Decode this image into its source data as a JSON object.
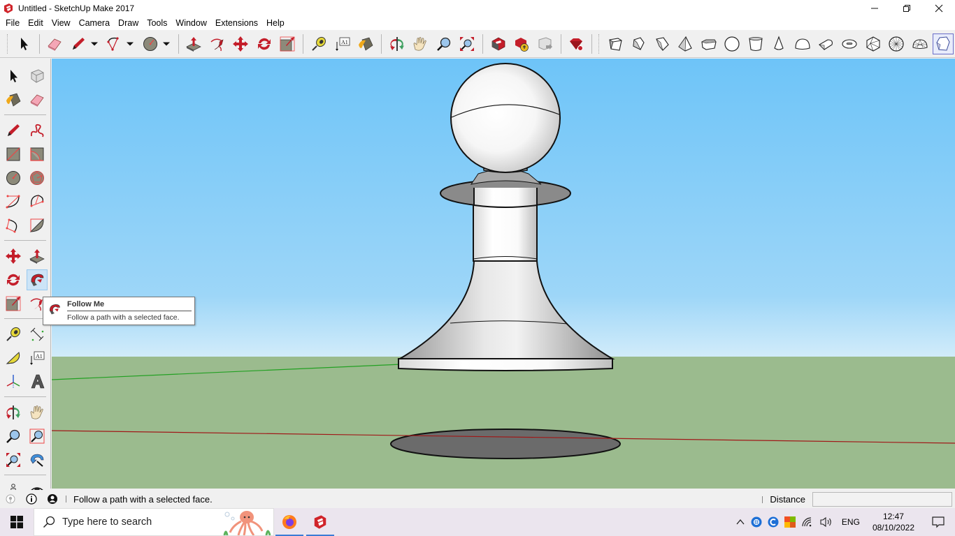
{
  "window": {
    "title": "Untitled - SketchUp Make 2017",
    "controls": [
      "minimize",
      "restore",
      "close"
    ]
  },
  "menu": [
    "File",
    "Edit",
    "View",
    "Camera",
    "Draw",
    "Tools",
    "Window",
    "Extensions",
    "Help"
  ],
  "toolbar": {
    "large_tools": [
      "select-icon",
      "eraser-icon",
      "pencil-icon",
      "arc-icon",
      "circle-icon",
      "push-pull-icon",
      "follow-me-icon",
      "move-icon",
      "rotate-icon",
      "scale-icon",
      "tape-measure-icon",
      "text-icon",
      "paint-bucket-icon",
      "orbit-icon",
      "pan-icon",
      "zoom-icon",
      "zoom-extents-icon",
      "warehouse-icon",
      "extension-warehouse-icon",
      "layout-icon",
      "ruby-console-icon"
    ],
    "shapes": [
      "cube",
      "pentagonal-prism",
      "pentagonal-box",
      "tetrahedron",
      "octagonal-prism",
      "sphere",
      "cylinder",
      "cone",
      "dome",
      "half-cylinder",
      "torus",
      "icosahedron",
      "geodesic-sphere",
      "geodesic-dome",
      "selected-shape"
    ]
  },
  "left_toolbar": {
    "tools": [
      [
        "select",
        "make-component"
      ],
      [
        "paint-bucket",
        "eraser"
      ],
      [
        "line",
        "freehand"
      ],
      [
        "rectangle",
        "rotated-rectangle"
      ],
      [
        "circle",
        "polygon"
      ],
      [
        "arc",
        "two-point-arc"
      ],
      [
        "three-point-arc",
        "pie"
      ],
      [
        "move",
        "push-pull"
      ],
      [
        "rotate",
        "follow-me"
      ],
      [
        "scale",
        "offset"
      ],
      [
        "tape-measure",
        "dimension"
      ],
      [
        "protractor",
        "text"
      ],
      [
        "axes",
        "3d-text"
      ],
      [
        "orbit",
        "pan"
      ],
      [
        "zoom",
        "zoom-window"
      ],
      [
        "zoom-extents",
        "previous"
      ],
      [
        "position-camera",
        "look-around"
      ]
    ],
    "active": "follow-me"
  },
  "tooltip": {
    "title": "Follow Me",
    "description": "Follow a path with a selected face."
  },
  "viewport": {
    "sky_color": "#6ec4f8",
    "ground_color": "#9bbb8e",
    "model": "chess pawn",
    "axis_colors": {
      "green": "#22a022",
      "red": "#a01818"
    }
  },
  "statusbar": {
    "message": "Follow a path with a selected face.",
    "vcb_label": "Distance",
    "vcb_value": ""
  },
  "taskbar": {
    "search_placeholder": "Type here to search",
    "apps": [
      "firefox",
      "sketchup"
    ],
    "language": "ENG",
    "time": "12:47",
    "date": "08/10/2022"
  }
}
